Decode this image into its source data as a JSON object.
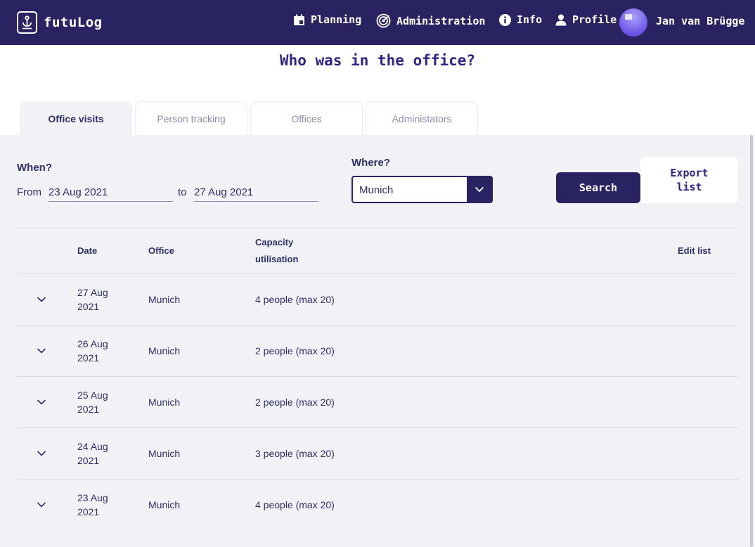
{
  "header": {
    "logo_text": "futuLog",
    "nav": [
      {
        "label": "Planning",
        "icon": "calendar-icon"
      },
      {
        "label": "Administration",
        "icon": "radar-icon"
      },
      {
        "label": "Info",
        "icon": "info-icon"
      },
      {
        "label": "Profile",
        "icon": "person-icon"
      }
    ],
    "user_name": "Jan van Brügge"
  },
  "page_title": "Who was in the office?",
  "tabs": [
    {
      "label": "Office visits",
      "active": true
    },
    {
      "label": "Person tracking",
      "active": false
    },
    {
      "label": "Offices",
      "active": false
    },
    {
      "label": "Administators",
      "active": false
    }
  ],
  "filters": {
    "when_label": "When?",
    "from_label": "From",
    "from_value": "23 Aug 2021",
    "to_label": "to",
    "to_value": "27 Aug 2021",
    "where_label": "Where?",
    "where_value": "Munich",
    "search_label": "Search",
    "export_label": "Export list"
  },
  "table": {
    "headers": {
      "date": "Date",
      "office": "Office",
      "capacity": "Capacity utilisation",
      "edit": "Edit list"
    },
    "rows": [
      {
        "date": "27 Aug 2021",
        "office": "Munich",
        "capacity": "4 people (max 20)"
      },
      {
        "date": "26 Aug 2021",
        "office": "Munich",
        "capacity": "2 people (max 20)"
      },
      {
        "date": "25 Aug 2021",
        "office": "Munich",
        "capacity": "2 people (max 20)"
      },
      {
        "date": "24 Aug 2021",
        "office": "Munich",
        "capacity": "3 people (max 20)"
      },
      {
        "date": "23 Aug 2021",
        "office": "Munich",
        "capacity": "4 people (max 20)"
      }
    ]
  },
  "colors": {
    "primary": "#2a2362",
    "title": "#2e2683",
    "panel": "#f2f2f6",
    "text": "#2d2f6b"
  }
}
